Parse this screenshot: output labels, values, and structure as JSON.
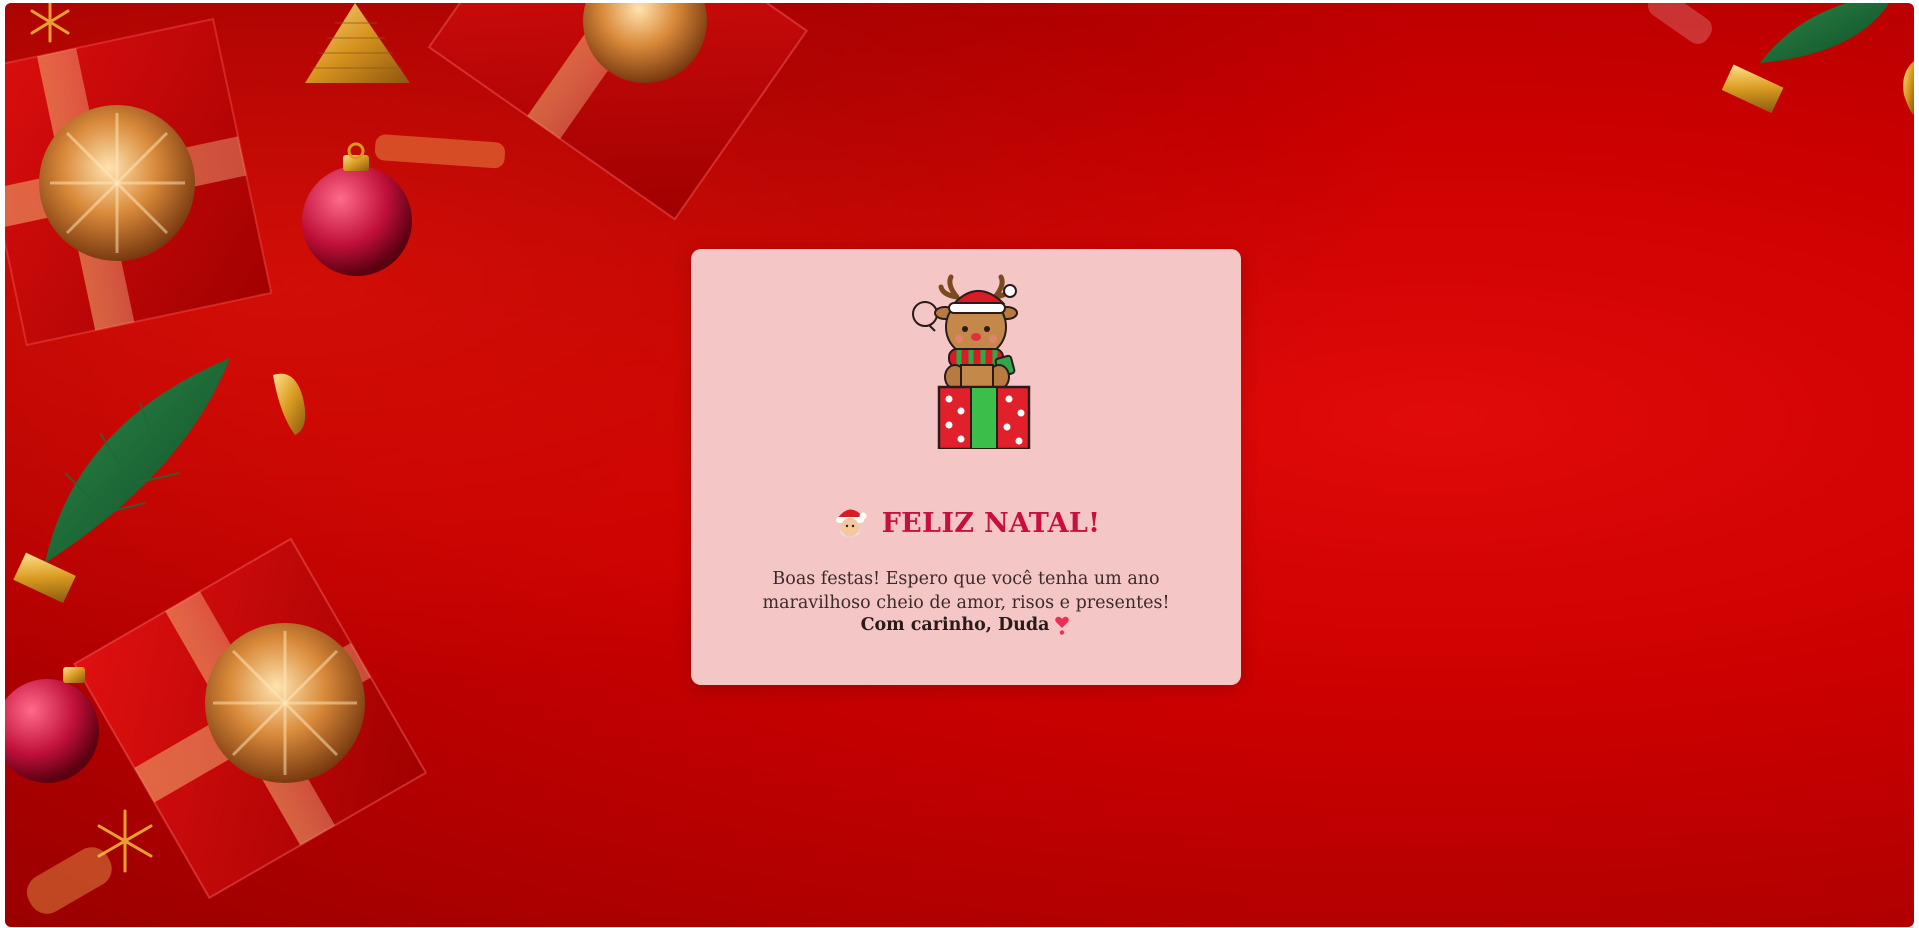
{
  "card": {
    "mascot_icon": "reindeer-on-gift-icon",
    "title_icon": "santa-claus-icon",
    "title": "FELIZ NATAL!",
    "message": "Boas festas! Espero que você tenha um ano maravilhoso cheio de amor, risos e presentes!",
    "signature": "Com carinho, Duda",
    "signature_icon": "heart-exclamation-icon"
  },
  "colors": {
    "background": "#cc0000",
    "card": "#f4c6c6",
    "title": "#c8103e",
    "text": "#3a2a2a"
  }
}
